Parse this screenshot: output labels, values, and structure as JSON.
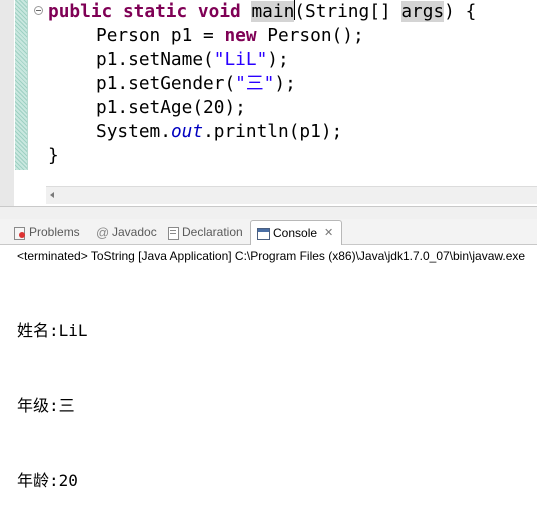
{
  "editor": {
    "code_lines": [
      [
        {
          "t": "public",
          "c": "kw"
        },
        {
          "t": " "
        },
        {
          "t": "static",
          "c": "kw"
        },
        {
          "t": " "
        },
        {
          "t": "void",
          "c": "kw"
        },
        {
          "t": " "
        },
        {
          "t": "main",
          "c": "hl"
        },
        {
          "t": "|",
          "c": "caret"
        },
        {
          "t": "(String[] "
        },
        {
          "t": "args",
          "c": "hl"
        },
        {
          "t": ") {"
        }
      ],
      [
        {
          "t": "",
          "c": "indent"
        },
        {
          "t": "Person p1 = "
        },
        {
          "t": "new",
          "c": "kw"
        },
        {
          "t": " Person();"
        }
      ],
      [
        {
          "t": "",
          "c": "indent"
        },
        {
          "t": "p1.setName("
        },
        {
          "t": "\"LiL\"",
          "c": "str"
        },
        {
          "t": ");"
        }
      ],
      [
        {
          "t": "",
          "c": "indent"
        },
        {
          "t": "p1.setGender("
        },
        {
          "t": "\"三\"",
          "c": "str"
        },
        {
          "t": ");"
        }
      ],
      [
        {
          "t": "",
          "c": "indent"
        },
        {
          "t": "p1.setAge(20);"
        }
      ],
      [
        {
          "t": "",
          "c": "indent"
        },
        {
          "t": "System."
        },
        {
          "t": "out",
          "c": "field"
        },
        {
          "t": ".println(p1);"
        }
      ],
      [
        {
          "t": "}"
        }
      ]
    ]
  },
  "views": {
    "tabs": [
      {
        "label": "Problems",
        "icon": "problems-icon",
        "active": false
      },
      {
        "label": "Javadoc",
        "icon": "javadoc-icon",
        "active": false
      },
      {
        "label": "Declaration",
        "icon": "declaration-icon",
        "active": false
      },
      {
        "label": "Console",
        "icon": "console-icon",
        "active": true
      }
    ],
    "close_glyph": "✕"
  },
  "console": {
    "header": "<terminated> ToString [Java Application] C:\\Program Files (x86)\\Java\\jdk1.7.0_07\\bin\\javaw.exe",
    "output_lines": [
      "姓名:LiL",
      "年级:三",
      "年龄:20"
    ]
  }
}
